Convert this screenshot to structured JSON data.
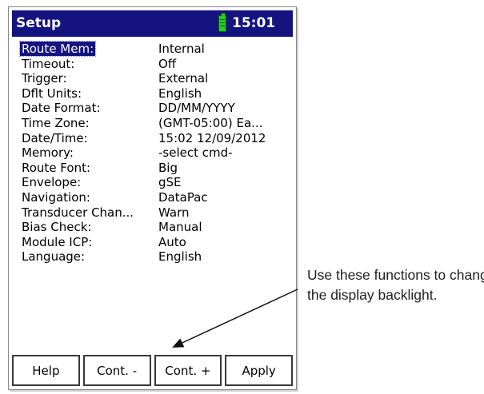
{
  "window": {
    "title": "Setup",
    "time": "15:01"
  },
  "settings": [
    {
      "label": "Route Mem:",
      "value": "Internal",
      "selected": true
    },
    {
      "label": "Timeout:",
      "value": "Off"
    },
    {
      "label": "Trigger:",
      "value": "External"
    },
    {
      "label": "Dflt Units:",
      "value": "English"
    },
    {
      "label": "Date Format:",
      "value": "DD/MM/YYYY"
    },
    {
      "label": "Time Zone:",
      "value": "(GMT-05:00) Ea..."
    },
    {
      "label": "Date/Time:",
      "value": "15:02 12/09/2012"
    },
    {
      "label": "Memory:",
      "value": "-select cmd-"
    },
    {
      "label": "Route Font:",
      "value": "Big"
    },
    {
      "label": "Envelope:",
      "value": "gSE"
    },
    {
      "label": "Navigation:",
      "value": "DataPac"
    },
    {
      "label": "Transducer Chan...",
      "value": "Warn"
    },
    {
      "label": "Bias Check:",
      "value": "Manual"
    },
    {
      "label": "Module ICP:",
      "value": "Auto"
    },
    {
      "label": "Language:",
      "value": "English"
    }
  ],
  "buttons": {
    "help": "Help",
    "cont_minus": "Cont. -",
    "cont_plus": "Cont. +",
    "apply": "Apply"
  },
  "annotation": {
    "line1": "Use these functions to change",
    "line2": "the display backlight."
  },
  "icons": {
    "battery": "battery-icon",
    "arrow": "callout-arrow"
  },
  "colors": {
    "titlebar": "#14137f",
    "battery": "#1ed21e"
  }
}
